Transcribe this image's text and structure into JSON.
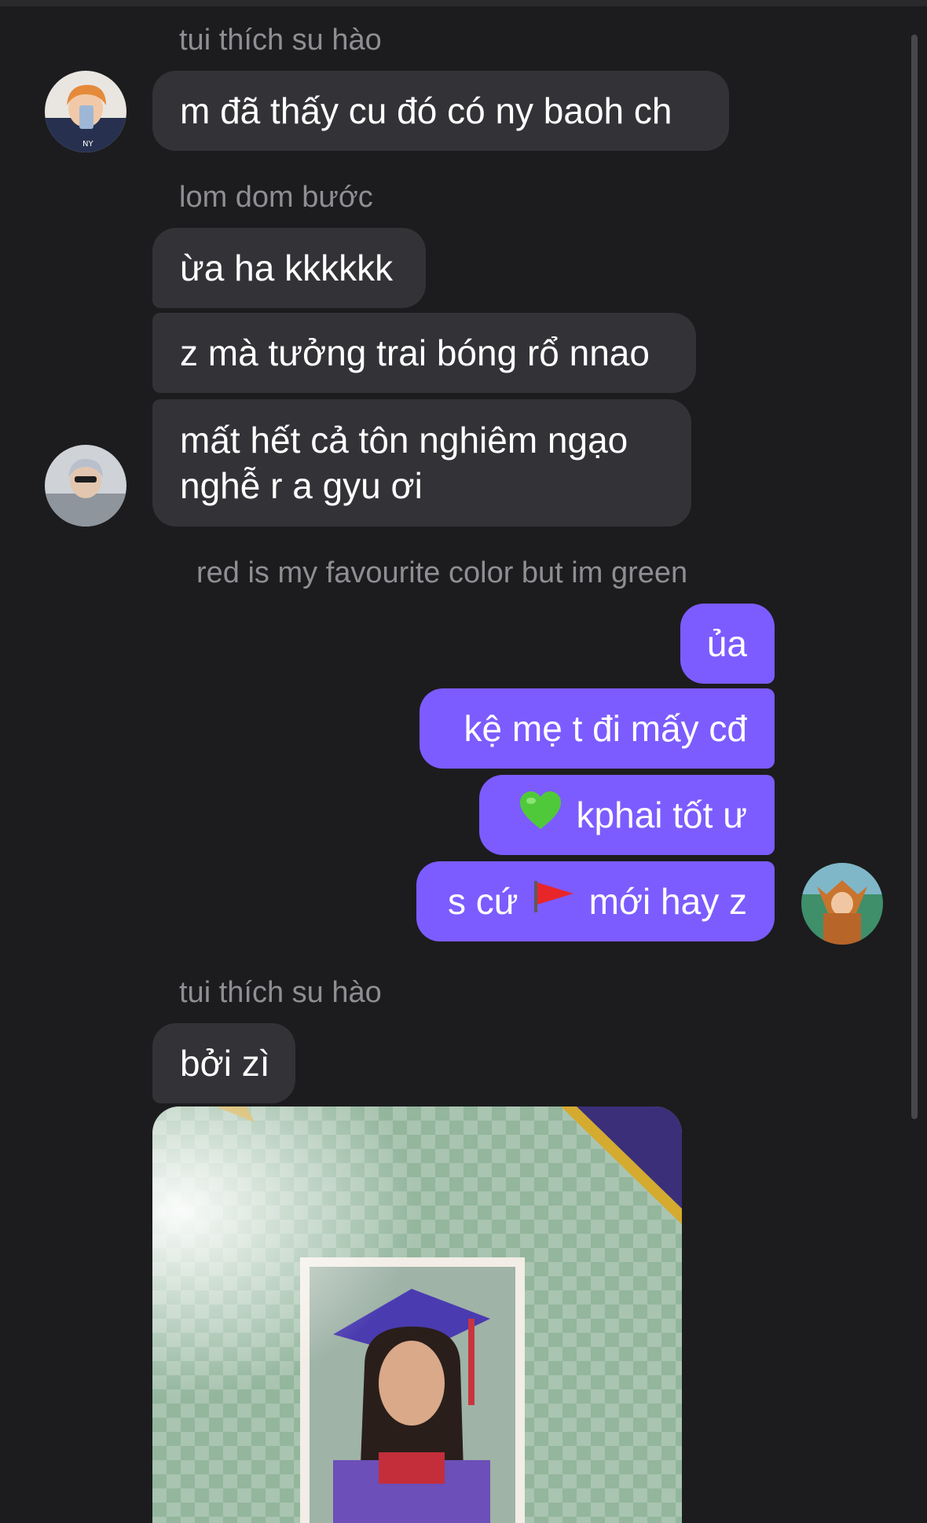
{
  "messages": {
    "group1": {
      "sender": "tui thích su hào",
      "text": "m đã thấy cu đó có ny baoh ch"
    },
    "group2": {
      "sender": "lom dom bước",
      "texts": [
        "ừa ha kkkkkk",
        "z mà tưởng trai bóng rổ nnao",
        "mất hết cả tôn nghiêm ngạo nghễ r a gyu ơi"
      ]
    },
    "group3": {
      "sender": "red is my favourite color but im green",
      "texts": [
        "ủa",
        "kệ mẹ t đi mấy cđ",
        "kphai tốt ư",
        "s cứ",
        "mới hay z"
      ],
      "emoji_heart": "green-heart",
      "emoji_flag": "red-triangular-flag"
    },
    "group4": {
      "sender": "tui thích su hào",
      "text": "bởi zì",
      "photo": "graduation-yearbook-photo"
    }
  },
  "colors": {
    "background": "#1c1c1e",
    "incoming_bubble": "#333337",
    "outgoing_bubble": "#7c5cff",
    "sender_name": "#8e8e93"
  }
}
